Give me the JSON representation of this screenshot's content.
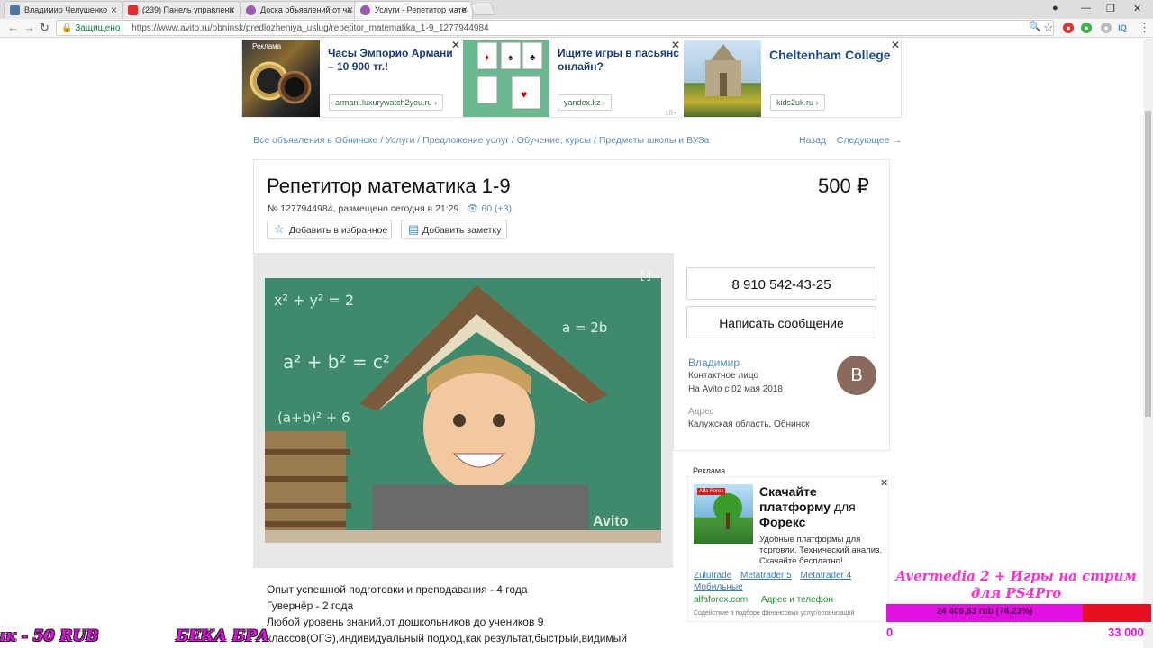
{
  "browser": {
    "tabs": [
      {
        "label": "Владимир Челушенко",
        "icon": "vk-icon",
        "color": "#4a76a8"
      },
      {
        "label": "(239) Панель управлени",
        "icon": "youtube-icon",
        "color": "#e52d27"
      },
      {
        "label": "Доска объявлений от ча",
        "icon": "avito-icon",
        "color": "#9b59b6"
      },
      {
        "label": "Услуги - Репетитор мате",
        "icon": "avito-icon",
        "color": "#9b59b6"
      }
    ],
    "secure_label": "Защищено",
    "url": "https://www.avito.ru/obninsk/predlozheniya_uslug/repetitor_matematika_1-9_1277944984"
  },
  "ads_top": [
    {
      "title": "Часы Эмпорио Армани – 10 900 тг.!",
      "link": "armani.luxurywatch2you.ru ›",
      "badge": "Реклама"
    },
    {
      "title": "Ищите игры в пасьянс онлайн?",
      "link": "yandex.kz ›",
      "age": "18+"
    },
    {
      "title": "Cheltenham College",
      "link": "kids2uk.ru ›"
    }
  ],
  "breadcrumbs": "Все объявления в Обнинске / Услуги / Предложение услуг / Обучение, курсы / Предметы школы и ВУЗа",
  "nav": {
    "back": "Назад",
    "next": "Следующее →"
  },
  "listing": {
    "title": "Репетитор математика 1-9",
    "price": "500 ₽",
    "meta": "№ 1277944984, размещено сегодня в 21:29",
    "views": "60 (+3)",
    "add_favorite": "Добавить в избранное",
    "add_note": "Добавить заметку",
    "watermark": "Avito"
  },
  "contact": {
    "phone": "8 910 542-43-25",
    "message_button": "Написать сообщение",
    "seller_name": "Владимир",
    "seller_role": "Контактное лицо",
    "seller_since": "На Avito с 02 мая 2018",
    "avatar_letter": "В",
    "address_label": "Адрес",
    "address": "Калужская область, Обнинск"
  },
  "side_ad": {
    "label": "Реклама",
    "title_bold1": "Скачайте",
    "title_bold2": "платформу",
    "title_norm": " для",
    "title_bold3": "Форекс",
    "body": "Удобные платформы для торговли. Технический анализ. Скачайте бесплатно!",
    "links": [
      "Zulutrade",
      "Metatrader 5",
      "Metatrader 4",
      "Мобильные"
    ],
    "domain": "alfaforex.com",
    "address_link": "Адрес и телефон",
    "tiny": "Содействие в подборе финансовых услуг/организаций",
    "img_text": "Alfa Forex"
  },
  "description": [
    "Опыт успешной подготовки и преподавания - 4 года",
    "Гувернёр - 2 года",
    "Любой уровень знаний,от дошкольников до учеников 9",
    "классов(ОГЭ),индивидуальный подход,как результат,быстрый,видимый"
  ],
  "overlay": {
    "title": "Avermedia 2 + Игры на стрим для PS4Pro",
    "progress_text": "24 406,63 rub (74.23%)",
    "progress": 0.7423,
    "min": "0",
    "max": "33 000",
    "ticker_left": "ик - 50 RUB",
    "ticker_right": "БЕКА БРА"
  }
}
